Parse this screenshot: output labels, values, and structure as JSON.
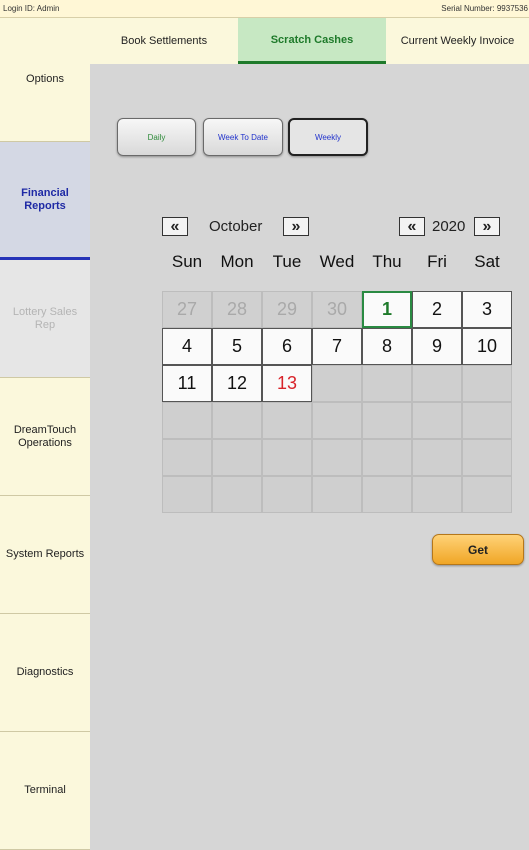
{
  "status_bar": {
    "login": "Login ID: Admin",
    "serial": "Serial Number: 9937536"
  },
  "sidebar": {
    "items": [
      {
        "label": "Options",
        "state": "normal"
      },
      {
        "label": "Financial Reports",
        "state": "active"
      },
      {
        "label": "Lottery Sales Rep",
        "state": "disabled"
      },
      {
        "label": "DreamTouch Operations",
        "state": "normal"
      },
      {
        "label": "System Reports",
        "state": "normal"
      },
      {
        "label": "Diagnostics",
        "state": "normal"
      },
      {
        "label": "Terminal",
        "state": "normal"
      }
    ]
  },
  "tabs": [
    {
      "label": "Book Settlements",
      "active": false
    },
    {
      "label": "Scratch Cashes",
      "active": true
    },
    {
      "label": "Current Weekly Invoice",
      "active": false
    }
  ],
  "report_modes": [
    {
      "label": "Daily",
      "color": "#2e8b3a",
      "selected": false
    },
    {
      "label": "Week To Date",
      "color": "#2233cc",
      "selected": false
    },
    {
      "label": "Weekly",
      "color": "#2233cc",
      "selected": true
    }
  ],
  "calendar": {
    "month": "October",
    "year": "2020",
    "prev_icon": "«",
    "next_icon": "»",
    "weekdays": [
      "Sun",
      "Mon",
      "Tue",
      "Wed",
      "Thu",
      "Fri",
      "Sat"
    ],
    "cells": [
      {
        "day": "27",
        "state": "other"
      },
      {
        "day": "28",
        "state": "other"
      },
      {
        "day": "29",
        "state": "other"
      },
      {
        "day": "30",
        "state": "other"
      },
      {
        "day": "1",
        "state": "today"
      },
      {
        "day": "2",
        "state": "cur"
      },
      {
        "day": "3",
        "state": "cur"
      },
      {
        "day": "4",
        "state": "cur"
      },
      {
        "day": "5",
        "state": "cur"
      },
      {
        "day": "6",
        "state": "cur"
      },
      {
        "day": "7",
        "state": "cur"
      },
      {
        "day": "8",
        "state": "cur"
      },
      {
        "day": "9",
        "state": "cur"
      },
      {
        "day": "10",
        "state": "cur"
      },
      {
        "day": "11",
        "state": "cur"
      },
      {
        "day": "12",
        "state": "cur"
      },
      {
        "day": "13",
        "state": "sel"
      },
      {
        "day": "",
        "state": "empty"
      },
      {
        "day": "",
        "state": "empty"
      },
      {
        "day": "",
        "state": "empty"
      },
      {
        "day": "",
        "state": "empty"
      },
      {
        "day": "",
        "state": "empty"
      },
      {
        "day": "",
        "state": "empty"
      },
      {
        "day": "",
        "state": "empty"
      },
      {
        "day": "",
        "state": "empty"
      },
      {
        "day": "",
        "state": "empty"
      },
      {
        "day": "",
        "state": "empty"
      },
      {
        "day": "",
        "state": "empty"
      },
      {
        "day": "",
        "state": "empty"
      },
      {
        "day": "",
        "state": "empty"
      },
      {
        "day": "",
        "state": "empty"
      },
      {
        "day": "",
        "state": "empty"
      },
      {
        "day": "",
        "state": "empty"
      },
      {
        "day": "",
        "state": "empty"
      },
      {
        "day": "",
        "state": "empty"
      },
      {
        "day": "",
        "state": "empty"
      },
      {
        "day": "",
        "state": "empty"
      },
      {
        "day": "",
        "state": "empty"
      },
      {
        "day": "",
        "state": "empty"
      },
      {
        "day": "",
        "state": "empty"
      },
      {
        "day": "",
        "state": "empty"
      },
      {
        "day": "",
        "state": "empty"
      }
    ]
  },
  "get_button": {
    "label": "Get"
  }
}
